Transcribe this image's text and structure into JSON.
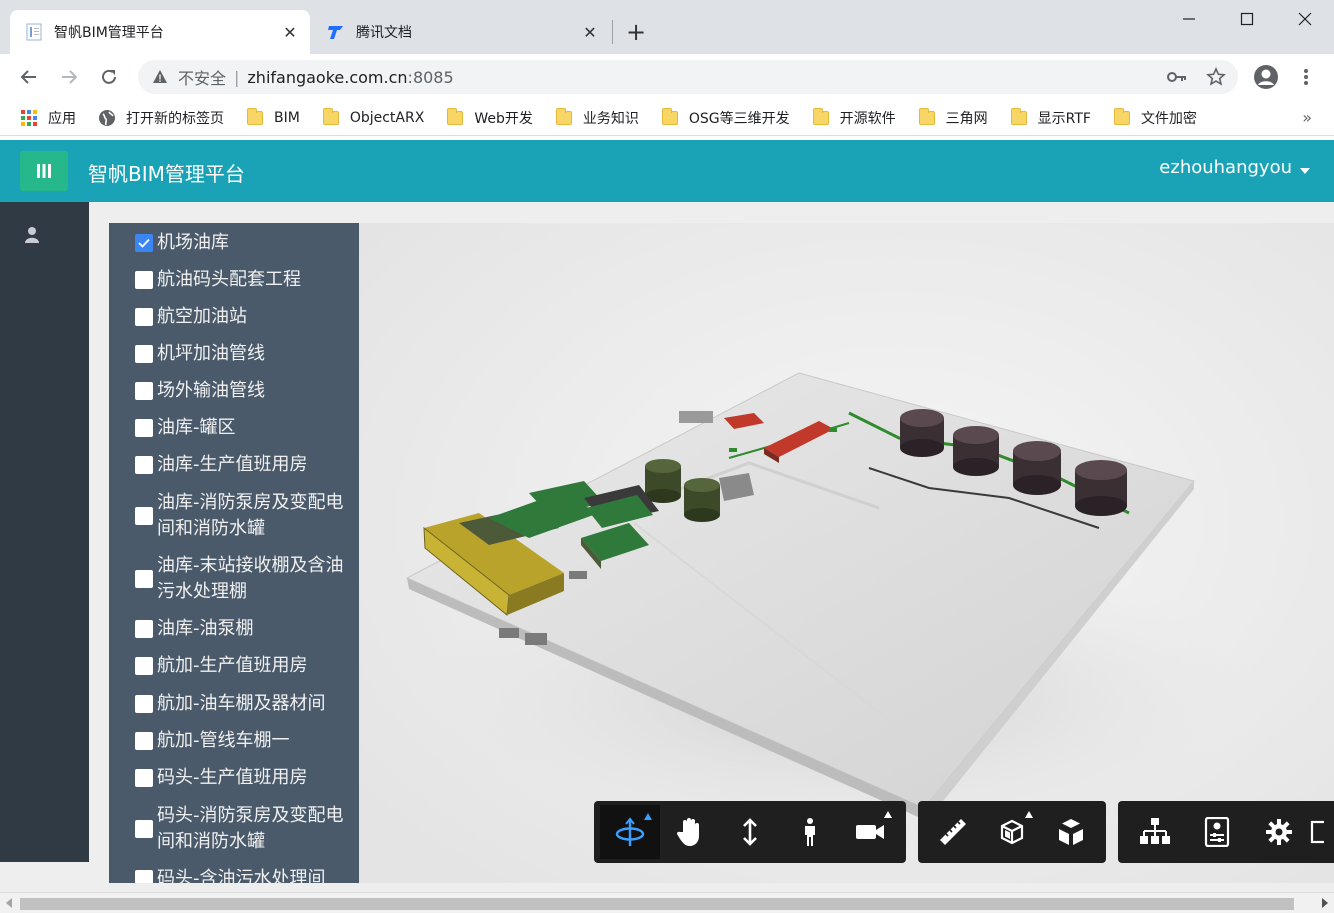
{
  "browser": {
    "tabs": [
      {
        "title": "智帆BIM管理平台",
        "active": true
      },
      {
        "title": "腾讯文档",
        "active": false
      }
    ],
    "close_glyph": "✕",
    "new_tab_glyph": "+",
    "window_controls": {
      "minimize": "—",
      "maximize": "☐",
      "close": "✕"
    },
    "address": {
      "security_label": "不安全",
      "separator": "|",
      "host": "zhifangaoke.com.cn",
      "port": ":8085"
    },
    "bookmarks": [
      {
        "label": "应用",
        "icon": "apps-grid-icon"
      },
      {
        "label": "打开新的标签页",
        "icon": "globe-icon"
      },
      {
        "label": "BIM",
        "icon": "folder-icon"
      },
      {
        "label": "ObjectARX",
        "icon": "folder-icon"
      },
      {
        "label": "Web开发",
        "icon": "folder-icon"
      },
      {
        "label": "业务知识",
        "icon": "folder-icon"
      },
      {
        "label": "OSG等三维开发",
        "icon": "folder-icon"
      },
      {
        "label": "开源软件",
        "icon": "folder-icon"
      },
      {
        "label": "三角网",
        "icon": "folder-icon"
      },
      {
        "label": "显示RTF",
        "icon": "folder-icon"
      },
      {
        "label": "文件加密",
        "icon": "folder-icon"
      }
    ],
    "bookmarks_more": "»"
  },
  "app": {
    "title": "智帆BIM管理平台",
    "user": "ezhouhangyou",
    "header_color": "#1aa2b6",
    "menu_button_color": "#26b88a"
  },
  "tree": {
    "items": [
      {
        "label": "机场油库",
        "checked": true
      },
      {
        "label": "航油码头配套工程",
        "checked": false
      },
      {
        "label": "航空加油站",
        "checked": false
      },
      {
        "label": "机坪加油管线",
        "checked": false
      },
      {
        "label": "场外输油管线",
        "checked": false
      },
      {
        "label": "油库-罐区",
        "checked": false
      },
      {
        "label": "油库-生产值班用房",
        "checked": false
      },
      {
        "label": "油库-消防泵房及变配电间和消防水罐",
        "checked": false
      },
      {
        "label": "油库-末站接收棚及含油污水处理棚",
        "checked": false
      },
      {
        "label": "油库-油泵棚",
        "checked": false
      },
      {
        "label": "航加-生产值班用房",
        "checked": false
      },
      {
        "label": "航加-油车棚及器材间",
        "checked": false
      },
      {
        "label": "航加-管线车棚一",
        "checked": false
      },
      {
        "label": "码头-生产值班用房",
        "checked": false
      },
      {
        "label": "码头-消防泵房及变配电间和消防水罐",
        "checked": false
      },
      {
        "label": "码头-含油污水处理间",
        "checked": false
      }
    ]
  },
  "viewer_toolbar": {
    "groups": [
      {
        "tools": [
          {
            "name": "orbit-tool",
            "icon": "orbit-icon",
            "active": true,
            "submenu": true
          },
          {
            "name": "pan-tool",
            "icon": "hand-icon",
            "active": false,
            "submenu": false
          },
          {
            "name": "zoom-tool",
            "icon": "vertical-arrows-icon",
            "active": false,
            "submenu": false
          },
          {
            "name": "first-person-tool",
            "icon": "person-icon",
            "active": false,
            "submenu": false
          },
          {
            "name": "camera-tool",
            "icon": "camera-icon",
            "active": false,
            "submenu": true
          }
        ]
      },
      {
        "tools": [
          {
            "name": "measure-tool",
            "icon": "ruler-icon",
            "active": false,
            "submenu": false
          },
          {
            "name": "section-tool",
            "icon": "section-box-icon",
            "active": false,
            "submenu": true
          },
          {
            "name": "explode-tool",
            "icon": "explode-cube-icon",
            "active": false,
            "submenu": false
          }
        ]
      },
      {
        "tools": [
          {
            "name": "model-browser-tool",
            "icon": "hierarchy-icon",
            "active": false,
            "submenu": false
          },
          {
            "name": "properties-tool",
            "icon": "properties-icon",
            "active": false,
            "submenu": false
          },
          {
            "name": "settings-tool",
            "icon": "gear-icon",
            "active": false,
            "submenu": false
          },
          {
            "name": "fullscreen-tool",
            "icon": "fullscreen-icon",
            "active": false,
            "submenu": false
          }
        ]
      }
    ]
  }
}
